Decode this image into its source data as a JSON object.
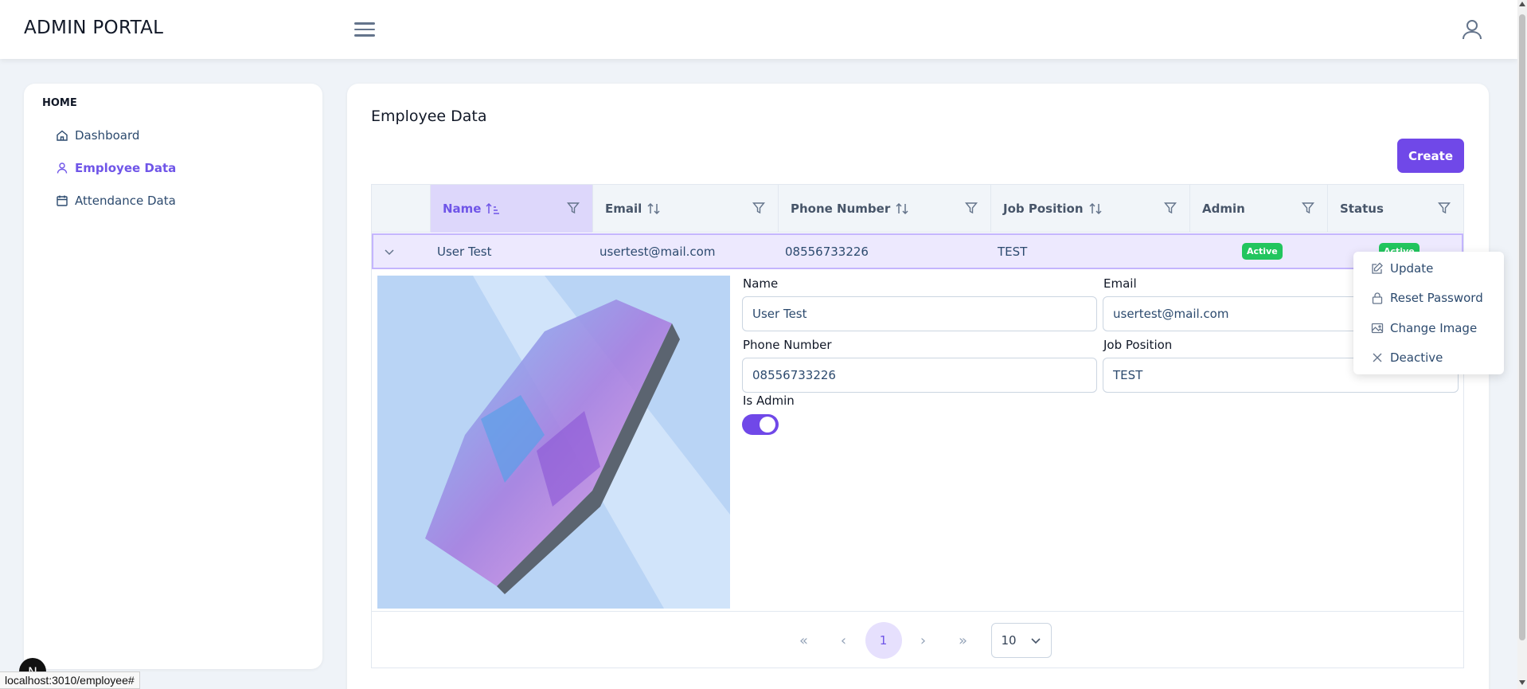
{
  "app": {
    "title": "ADMIN PORTAL"
  },
  "icons": {
    "menu": "hamburger-icon",
    "user": "user-icon",
    "home": "home-icon",
    "calendar": "calendar-icon",
    "filter": "filter-icon",
    "sort": "sort-icon",
    "edit": "edit-icon",
    "lock": "lock-icon",
    "image": "image-icon",
    "close": "close-icon"
  },
  "colors": {
    "accent": "#7048e8",
    "active_badge": "#22c55e",
    "text_link": "#2c4a6e"
  },
  "sidebar": {
    "heading": "HOME",
    "items": [
      {
        "label": "Dashboard",
        "active": false
      },
      {
        "label": "Employee Data",
        "active": true
      },
      {
        "label": "Attendance Data",
        "active": false
      }
    ]
  },
  "main": {
    "title": "Employee Data",
    "create_label": "Create"
  },
  "table": {
    "columns": [
      {
        "label": "Name",
        "sortable": true,
        "sorted": "asc"
      },
      {
        "label": "Email",
        "sortable": true
      },
      {
        "label": "Phone Number",
        "sortable": true
      },
      {
        "label": "Job Position",
        "sortable": true
      },
      {
        "label": "Admin",
        "sortable": false
      },
      {
        "label": "Status",
        "sortable": false
      }
    ],
    "rows": [
      {
        "name": "User Test",
        "email": "usertest@mail.com",
        "phone": "08556733226",
        "job": "TEST",
        "admin": "Active",
        "status": "Active"
      }
    ]
  },
  "detail": {
    "name_label": "Name",
    "name_value": "User Test",
    "email_label": "Email",
    "email_value": "usertest@mail.com",
    "phone_label": "Phone Number",
    "phone_value": "08556733226",
    "job_label": "Job Position",
    "job_value": "TEST",
    "is_admin_label": "Is Admin",
    "is_admin": true
  },
  "pagination": {
    "current_page": "1",
    "per_page": "10"
  },
  "context_menu": {
    "items": [
      {
        "label": "Update"
      },
      {
        "label": "Reset Password"
      },
      {
        "label": "Change Image"
      },
      {
        "label": "Deactive"
      }
    ]
  },
  "browser": {
    "status_url": "localhost:3010/employee#",
    "dev_badge": "N"
  }
}
